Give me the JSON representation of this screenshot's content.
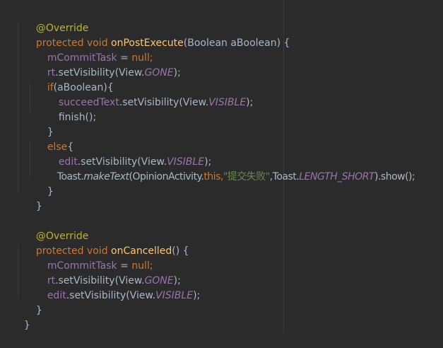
{
  "colors": {
    "background": "#2b2b2b",
    "plain": "#a9b7c6",
    "keyword": "#cc7832",
    "annotation": "#bbb529",
    "method_decl": "#ffc66d",
    "field": "#9876aa",
    "string": "#6a8759"
  },
  "code": {
    "l1": {
      "a": "@Override"
    },
    "l2": {
      "a": "protected void ",
      "b": "onPostExecute",
      "c": "(Boolean aBoolean) {"
    },
    "l3": {
      "a": "mCommitTask",
      "b": " = ",
      "c": "null",
      "d": ";"
    },
    "l4": {
      "a": "rt",
      "b": ".setVisibility(View.",
      "c": "GONE",
      "d": ");"
    },
    "l5": {
      "a": "if",
      "b": "(aBoolean){"
    },
    "l6": {
      "a": "succeedText",
      "b": ".setVisibility(View.",
      "c": "VISIBLE",
      "d": ");"
    },
    "l7": {
      "a": "finish();"
    },
    "l8": {
      "a": "}"
    },
    "l9": {
      "a": "else",
      "b": "{"
    },
    "l10": {
      "a": "edit",
      "b": ".setVisibility(View.",
      "c": "VISIBLE",
      "d": ");"
    },
    "l11": {
      "a": "Toast.",
      "b": "makeText",
      "c": "(OpinionActivity.",
      "d": "this",
      "e": ",",
      "f": "\"提交失败\"",
      "g": ",Toast.",
      "h": "LENGTH_SHORT",
      "i": ").show();"
    },
    "l12": {
      "a": "}"
    },
    "l13": {
      "a": "}"
    },
    "l15": {
      "a": "@Override"
    },
    "l16": {
      "a": "protected void ",
      "b": "onCancelled",
      "c": "() {"
    },
    "l17": {
      "a": "mCommitTask",
      "b": " = ",
      "c": "null",
      "d": ";"
    },
    "l18": {
      "a": "rt",
      "b": ".setVisibility(View.",
      "c": "GONE",
      "d": ");"
    },
    "l19": {
      "a": "edit",
      "b": ".setVisibility(View.",
      "c": "VISIBLE",
      "d": ");"
    },
    "l20": {
      "a": "}"
    },
    "l21": {
      "a": "}"
    }
  }
}
